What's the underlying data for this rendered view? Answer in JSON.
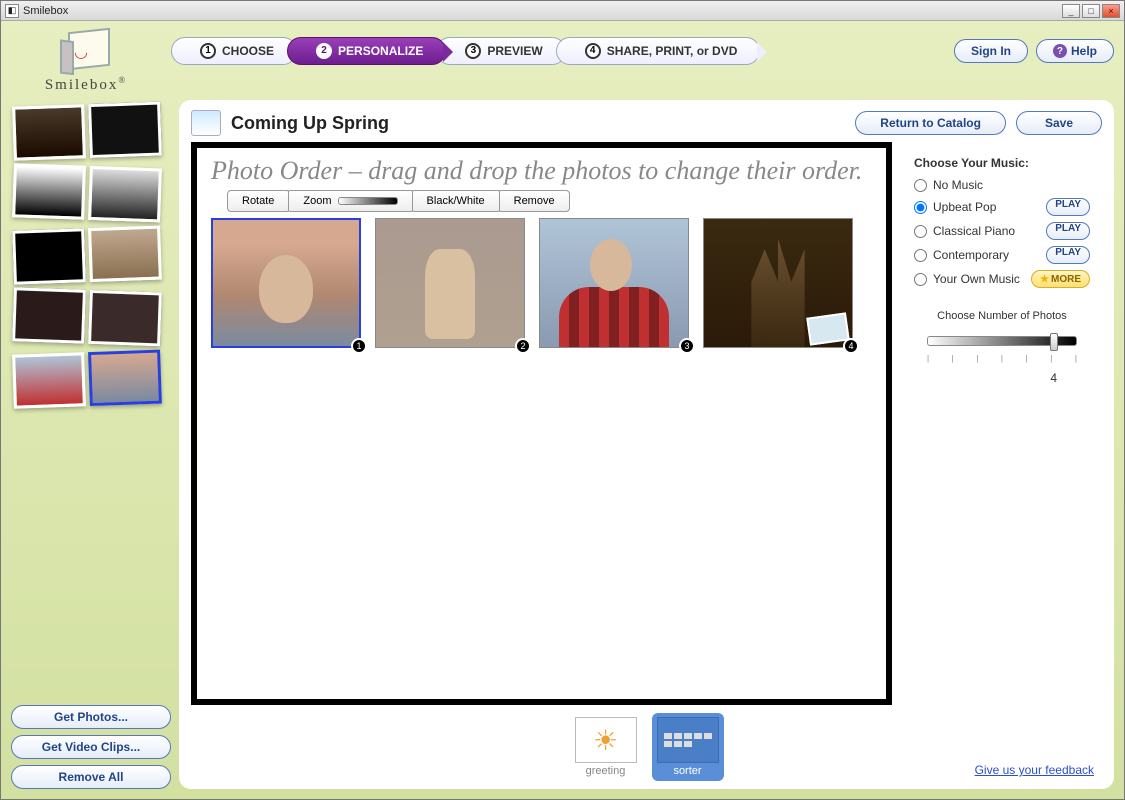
{
  "window": {
    "title": "Smilebox"
  },
  "brand": {
    "name": "Smilebox"
  },
  "steps": [
    {
      "num": "1",
      "label": "CHOOSE"
    },
    {
      "num": "2",
      "label": "PERSONALIZE"
    },
    {
      "num": "3",
      "label": "PREVIEW"
    },
    {
      "num": "4",
      "label": "SHARE, PRINT, or DVD"
    }
  ],
  "topButtons": {
    "signIn": "Sign In",
    "help": "Help"
  },
  "sidebarButtons": {
    "getPhotos": "Get Photos...",
    "getVideo": "Get Video Clips...",
    "removeAll": "Remove All"
  },
  "project": {
    "title": "Coming Up Spring"
  },
  "headButtons": {
    "returnCatalog": "Return to Catalog",
    "save": "Save"
  },
  "instruction": "Photo Order – drag and drop the photos to change their order.",
  "photoTools": {
    "rotate": "Rotate",
    "zoom": "Zoom",
    "bw": "Black/White",
    "remove": "Remove"
  },
  "photos": [
    {
      "n": "1"
    },
    {
      "n": "2"
    },
    {
      "n": "3"
    },
    {
      "n": "4"
    }
  ],
  "bottomTabs": {
    "greeting": "greeting",
    "sorter": "sorter"
  },
  "music": {
    "heading": "Choose Your Music:",
    "options": {
      "none": "No Music",
      "upbeat": "Upbeat Pop",
      "classical": "Classical Piano",
      "contemporary": "Contemporary",
      "own": "Your Own Music"
    },
    "play": "PLAY",
    "more": "MORE"
  },
  "photoCount": {
    "label": "Choose Number of Photos",
    "value": "4"
  },
  "feedback": "Give us your feedback"
}
